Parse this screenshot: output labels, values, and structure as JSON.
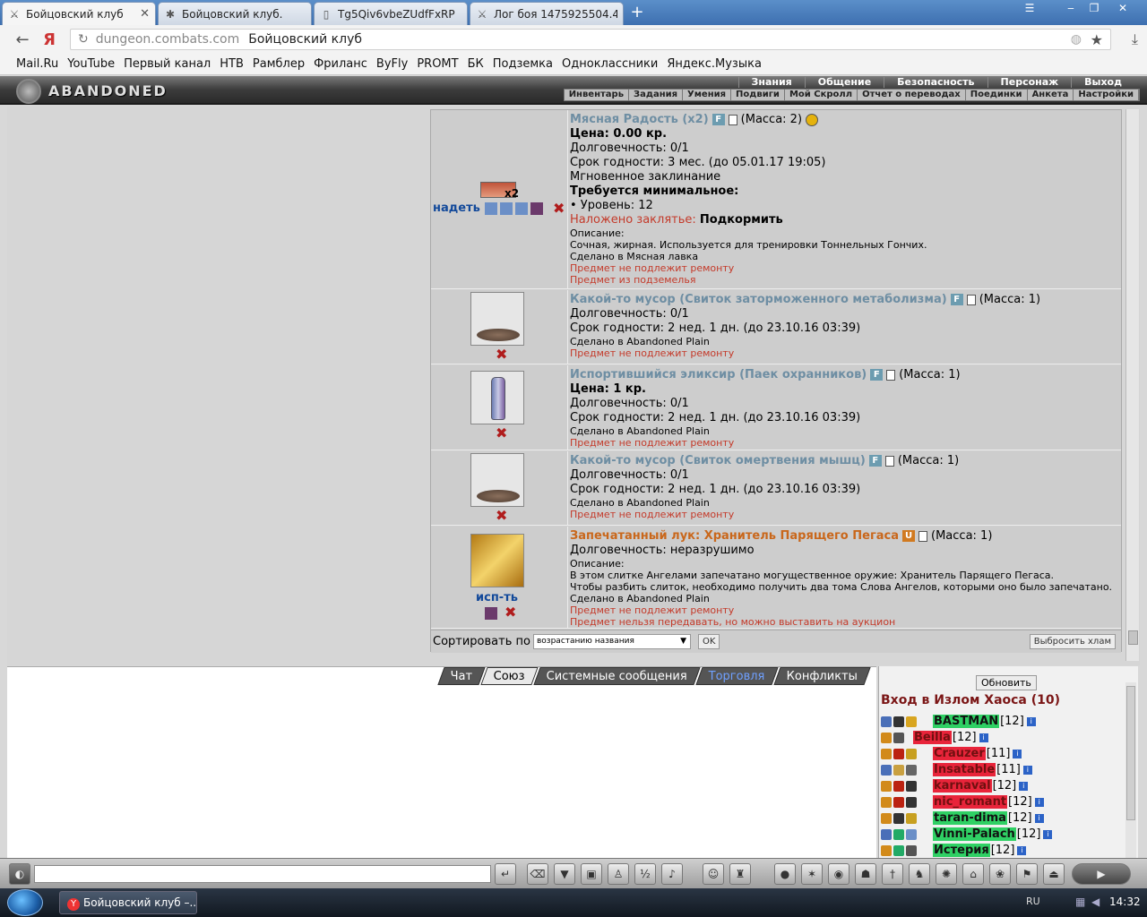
{
  "browser": {
    "tabs": [
      {
        "label": "Бойцовский клуб",
        "icon": "swords-icon"
      },
      {
        "label": "Бойцовский клуб.",
        "icon": "bee-icon"
      },
      {
        "label": "Tg5Qiv6vbeZUdfFxRP",
        "icon": "doc-icon"
      },
      {
        "label": "Лог боя 1475925504.4",
        "icon": "swords-icon"
      }
    ],
    "url_domain": "dungeon.combats.com",
    "page_title": "Бойцовский клуб",
    "bookmarks": [
      "Mail.Ru",
      "YouTube",
      "Первый канал",
      "НТВ",
      "Рамблер",
      "Фриланс",
      "ByFly",
      "PROMT",
      "БК",
      "Подземка",
      "Одноклассники",
      "Яндекс.Музыка"
    ]
  },
  "game_header": {
    "logo": "ABANDONED PLAIN",
    "top_nav": [
      "Знания",
      "Общение",
      "Безопасность",
      "Персонаж",
      "Выход"
    ],
    "sub_nav": [
      "Инвентарь",
      "Задания",
      "Умения",
      "Подвиги",
      "Мой Скролл",
      "Отчет о переводах",
      "Поединки",
      "Анкета",
      "Настройки"
    ]
  },
  "items": [
    {
      "name": "Мясная Радость (x2)",
      "badge": "F",
      "mass": "(Масса: 2)",
      "price": "Цена: 0.00 кр.",
      "durability": "Долговечность: 0/1",
      "expiry": "Срок годности: 3 мес. (до 05.01.17 19:05)",
      "type_line": "Мгновенное заклинание",
      "req_title": "Требуется минимальное:",
      "req_level": "• Уровень: 12",
      "spell_label": "Наложено заклятье:",
      "spell_value": "Подкормить",
      "desc_label": "Описание:",
      "desc": "Сочная, жирная. Используется для тренировки Тоннельных Гончих.",
      "made_in": "Сделано в Мясная лавка",
      "note1": "Предмет не подлежит ремонту",
      "note2": "Предмет из подземелья",
      "action": "надеть",
      "count": "x2"
    },
    {
      "name": "Какой-то мусор (Свиток заторможенного метаболизма)",
      "badge": "F",
      "mass": "(Масса: 1)",
      "durability": "Долговечность: 0/1",
      "expiry": "Срок годности: 2 нед. 1 дн. (до 23.10.16 03:39)",
      "made_in": "Сделано в Abandoned Plain",
      "note1": "Предмет не подлежит ремонту"
    },
    {
      "name": "Испортившийся эликсир (Паек охранников)",
      "badge": "F",
      "mass": "(Масса: 1)",
      "price": "Цена: 1 кр.",
      "durability": "Долговечность: 0/1",
      "expiry": "Срок годности: 2 нед. 1 дн. (до 23.10.16 03:39)",
      "made_in": "Сделано в Abandoned Plain",
      "note1": "Предмет не подлежит ремонту"
    },
    {
      "name": "Какой-то мусор (Свиток омертвения мышц)",
      "badge": "F",
      "mass": "(Масса: 1)",
      "durability": "Долговечность: 0/1",
      "expiry": "Срок годности: 2 нед. 1 дн. (до 23.10.16 03:39)",
      "made_in": "Сделано в Abandoned Plain",
      "note1": "Предмет не подлежит ремонту"
    },
    {
      "name": "Запечатанный лук: Хранитель Парящего Пегаса",
      "badge": "U",
      "mass": "(Масса: 1)",
      "durability": "Долговечность: неразрушимо",
      "desc_label": "Описание:",
      "desc": "В этом слитке Ангелами запечатано могущественное оружие: Хранитель Парящего Пегаса.",
      "desc2": "Чтобы разбить слиток, необходимо получить два тома Слова Ангелов, которыми оно было запечатано.",
      "made_in": "Сделано в Abandoned Plain",
      "note1": "Предмет не подлежит ремонту",
      "note2": "Предмет нельзя передавать, но можно выставить на аукцион",
      "action": "исп-ть"
    }
  ],
  "sort": {
    "label": "Сортировать по",
    "value": "возрастанию названия",
    "ok": "OK",
    "discard": "Выбросить хлам"
  },
  "chat_tabs": [
    "Чат",
    "Союз",
    "Системные сообщения",
    "Торговля",
    "Конфликты"
  ],
  "users": {
    "refresh": "Обновить",
    "title": "Вход в Излом Хаоса (10)",
    "list": [
      {
        "name": "BASTMAN",
        "level": "[12]",
        "color": "g"
      },
      {
        "name": "Beilla",
        "level": "[12]",
        "color": "r"
      },
      {
        "name": "Crauzer",
        "level": "[11]",
        "color": "r"
      },
      {
        "name": "Insatable",
        "level": "[11]",
        "color": "r"
      },
      {
        "name": "karnaval",
        "level": "[12]",
        "color": "r"
      },
      {
        "name": "nic_romant",
        "level": "[12]",
        "color": "r"
      },
      {
        "name": "taran-dima",
        "level": "[12]",
        "color": "g"
      },
      {
        "name": "Vinni-Palach",
        "level": "[12]",
        "color": "g"
      },
      {
        "name": "Истерия",
        "level": "[12]",
        "color": "g"
      }
    ]
  },
  "taskbar": {
    "item": "Бойцовский клуб –...",
    "lang": "RU",
    "time": "14:32"
  }
}
